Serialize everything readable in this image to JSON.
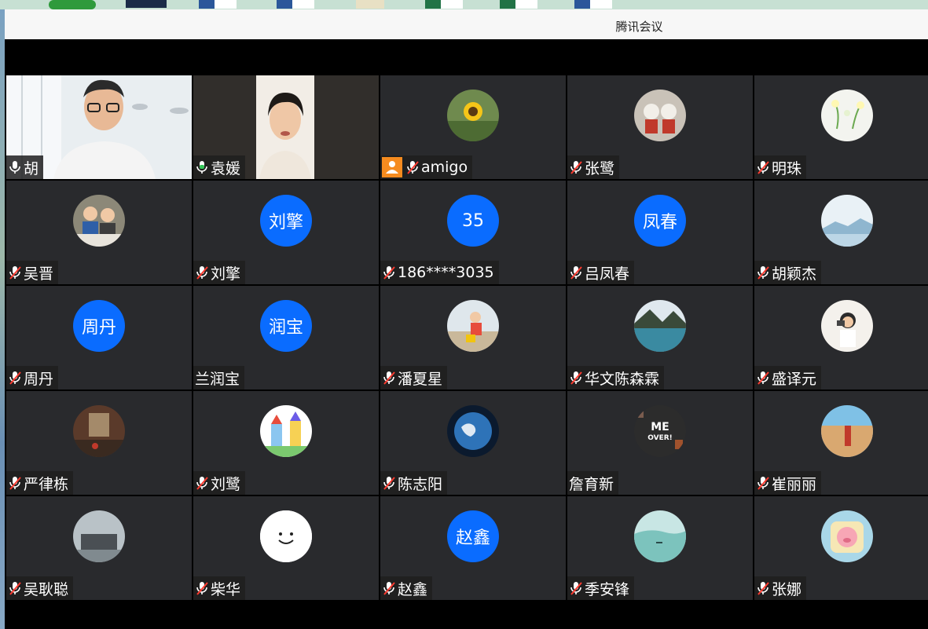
{
  "window": {
    "title": "腾讯会议"
  },
  "participants": [
    {
      "name": "胡",
      "mic": "on",
      "kind": "video",
      "avatar": "video-man"
    },
    {
      "name": "袁媛",
      "mic": "speaking",
      "kind": "video",
      "avatar": "video-woman"
    },
    {
      "name": "amigo",
      "mic": "off",
      "host": true,
      "kind": "photo",
      "avatar": "sunflower-photo"
    },
    {
      "name": "张鹭",
      "mic": "off",
      "kind": "photo",
      "avatar": "toys-photo"
    },
    {
      "name": "明珠",
      "mic": "off",
      "kind": "photo",
      "avatar": "flowers-photo"
    },
    {
      "name": "吴晋",
      "mic": "off",
      "kind": "photo",
      "avatar": "kids-photo"
    },
    {
      "name": "刘擎",
      "mic": "off",
      "kind": "text",
      "avatar_text": "刘擎"
    },
    {
      "name": "186****3035",
      "mic": "off",
      "kind": "text",
      "avatar_text": "35"
    },
    {
      "name": "吕凤春",
      "mic": "off",
      "kind": "text",
      "avatar_text": "凤春"
    },
    {
      "name": "胡颖杰",
      "mic": "off",
      "kind": "photo",
      "avatar": "landscape-photo"
    },
    {
      "name": "周丹",
      "mic": "off",
      "kind": "text",
      "avatar_text": "周丹"
    },
    {
      "name": "兰润宝",
      "mic": "none",
      "kind": "text",
      "avatar_text": "润宝"
    },
    {
      "name": "潘夏星",
      "mic": "off",
      "kind": "photo",
      "avatar": "beach-child-photo"
    },
    {
      "name": "华文陈森霖",
      "mic": "off",
      "kind": "photo",
      "avatar": "lake-photo"
    },
    {
      "name": "盛译元",
      "mic": "off",
      "kind": "photo",
      "avatar": "woman-camera-photo"
    },
    {
      "name": "严律栋",
      "mic": "off",
      "kind": "photo",
      "avatar": "hall-photo"
    },
    {
      "name": "刘鹭",
      "mic": "off",
      "kind": "photo",
      "avatar": "cartoon-castle-photo"
    },
    {
      "name": "陈志阳",
      "mic": "off",
      "kind": "photo",
      "avatar": "earth-photo"
    },
    {
      "name": "詹育新",
      "mic": "none",
      "kind": "photo",
      "avatar": "me-over-photo"
    },
    {
      "name": "崔丽丽",
      "mic": "off",
      "kind": "photo",
      "avatar": "beach-photo"
    },
    {
      "name": "吴耿聪",
      "mic": "off",
      "kind": "photo",
      "avatar": "building-photo"
    },
    {
      "name": "柴华",
      "mic": "off",
      "kind": "smiley",
      "avatar": "smiley-icon"
    },
    {
      "name": "赵鑫",
      "mic": "off",
      "kind": "text",
      "avatar_text": "赵鑫"
    },
    {
      "name": "季安锋",
      "mic": "off",
      "kind": "photo",
      "avatar": "misty-lake-photo"
    },
    {
      "name": "张娜",
      "mic": "off",
      "kind": "photo",
      "avatar": "pig-cartoon-photo"
    }
  ],
  "colors": {
    "text_avatar": "#0a6cff",
    "active_border": "#34c759",
    "host_badge": "#f58b1f",
    "tile_bg": "#292a2d"
  }
}
